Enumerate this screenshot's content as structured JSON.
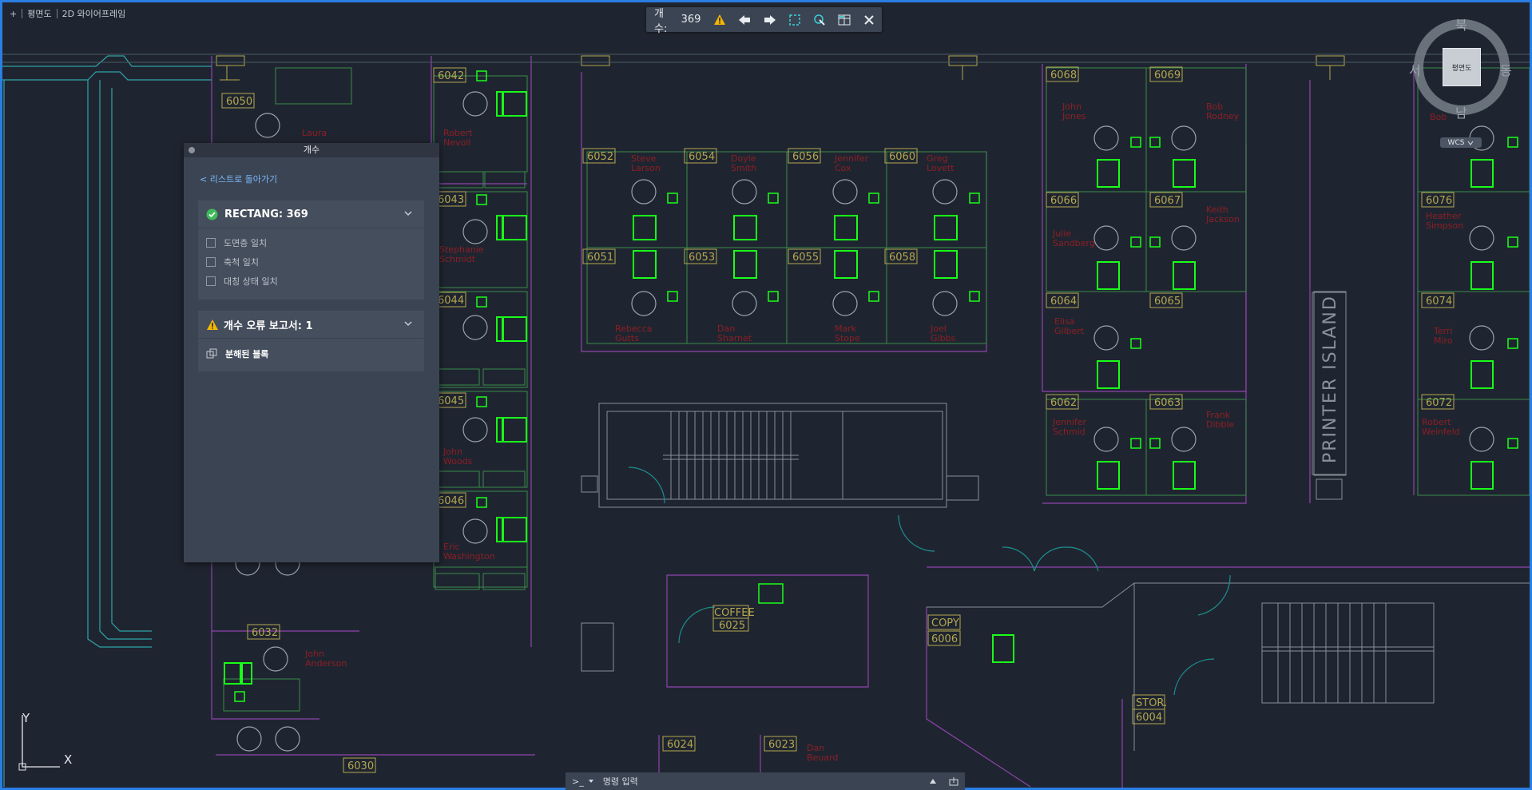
{
  "viewport": {
    "label_plus": "+",
    "view_name": "평면도",
    "visual_style": "2D 와이어프레임"
  },
  "countbar": {
    "label": "개수:",
    "count": "369"
  },
  "panel": {
    "title": "개수",
    "back_link": "< 리스트로 돌아가기",
    "block_card": {
      "label": "RECTANG: 369",
      "checks": [
        "도면층 일치",
        "축척 일치",
        "대칭 상태 일치"
      ]
    },
    "error_card": {
      "label": "개수 오류 보고서: 1",
      "item": "분해된 블록"
    }
  },
  "compass": {
    "north": "북",
    "south": "남",
    "east": "동",
    "west": "서",
    "center": "평면도",
    "wcs": "WCS"
  },
  "ucs": {
    "x": "X",
    "y": "Y"
  },
  "command_line": {
    "prompt": ">_",
    "placeholder": "명령 입력"
  },
  "drawing": {
    "rooms": [
      "6050",
      "6042",
      "6043",
      "6044",
      "6045",
      "6046",
      "6052",
      "6054",
      "6056",
      "6060",
      "6051",
      "6053",
      "6055",
      "6058",
      "6068",
      "6069",
      "6066",
      "6067",
      "6064",
      "6065",
      "6062",
      "6063",
      "6076",
      "6074",
      "6072",
      "6032",
      "6030",
      "6024",
      "6023",
      "6004",
      "6006",
      "6025"
    ],
    "names": [
      "Laura",
      "Robert Nevoll",
      "Steve Larson",
      "Doyle Smith",
      "Jennifer Cox",
      "Greg Lovett",
      "John Jones",
      "Bob Rodney",
      "Julie Sandberg",
      "Keith Jackson",
      "Elisa Gilbert",
      "Jennifer Schmid",
      "Frank Dibble",
      "Stephanie Schmidt",
      "Rebecca Gutts",
      "Dan Sharnet",
      "Mark Stope",
      "Joel Gibbs",
      "Heather Simpson",
      "Terri Miro",
      "Robert Weinfeld",
      "John Woods",
      "Eric Washington",
      "John Anderson",
      "Dan Beuard",
      "Bob"
    ],
    "labels": {
      "printer": "PRINTER ISLAND",
      "coffee": "COFFEE",
      "copy": "COPY",
      "stor": "STOR."
    }
  },
  "colors": {
    "accent": "#2b7ee3",
    "highlight": "#19ff19",
    "background": "#1f2530",
    "walls": "#8e44ad",
    "text_red": "#b02830",
    "room_tag": "#b5a74f"
  }
}
